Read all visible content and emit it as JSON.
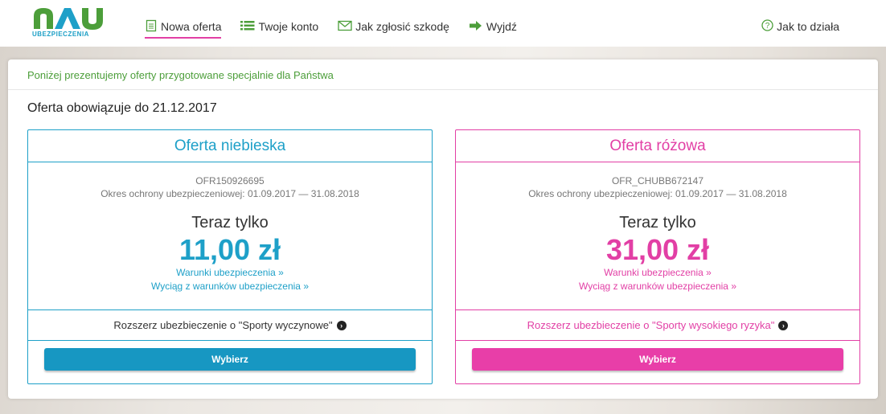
{
  "brand": {
    "logo_text": "NAU",
    "logo_sub": "UBEZPIECZENIA",
    "colors": {
      "blue": "#1ea0c8",
      "pink": "#e23fa5",
      "green": "#4c9e3a"
    }
  },
  "nav": {
    "items": [
      {
        "label": "Nowa oferta",
        "icon": "document-icon",
        "active": true
      },
      {
        "label": "Twoje konto",
        "icon": "list-icon",
        "active": false
      },
      {
        "label": "Jak zgłosić szkodę",
        "icon": "envelope-icon",
        "active": false
      },
      {
        "label": "Wyjdź",
        "icon": "exit-arrow-icon",
        "active": false
      }
    ],
    "help_label": "Jak to działa"
  },
  "main": {
    "intro": "Poniżej prezentujemy oferty przygotowane specjalnie dla Państwa",
    "valid_until": "Oferta obowiązuje do 21.12.2017",
    "offers": [
      {
        "title": "Oferta niebieska",
        "id": "OFR150926695",
        "period": "Okres ochrony ubezpieczeniowej: 01.09.2017 — 31.08.2018",
        "now_only": "Teraz tylko",
        "price": "11,00 zł",
        "terms_link": "Warunki ubezpieczenia »",
        "excerpt_link": "Wyciąg z warunków ubezpieczenia »",
        "extend": "Rozszerz ubezbieczenie o \"Sporty wyczynowe\"",
        "choose": "Wybierz"
      },
      {
        "title": "Oferta różowa",
        "id": "OFR_CHUBB672147",
        "period": "Okres ochrony ubezpieczeniowej: 01.09.2017 — 31.08.2018",
        "now_only": "Teraz tylko",
        "price": "31,00 zł",
        "terms_link": "Warunki ubezpieczenia »",
        "excerpt_link": "Wyciąg z warunków ubezpieczenia »",
        "extend": "Rozszerz ubezbieczenie o \"Sporty wysokiego ryzyka\"",
        "choose": "Wybierz"
      }
    ]
  }
}
